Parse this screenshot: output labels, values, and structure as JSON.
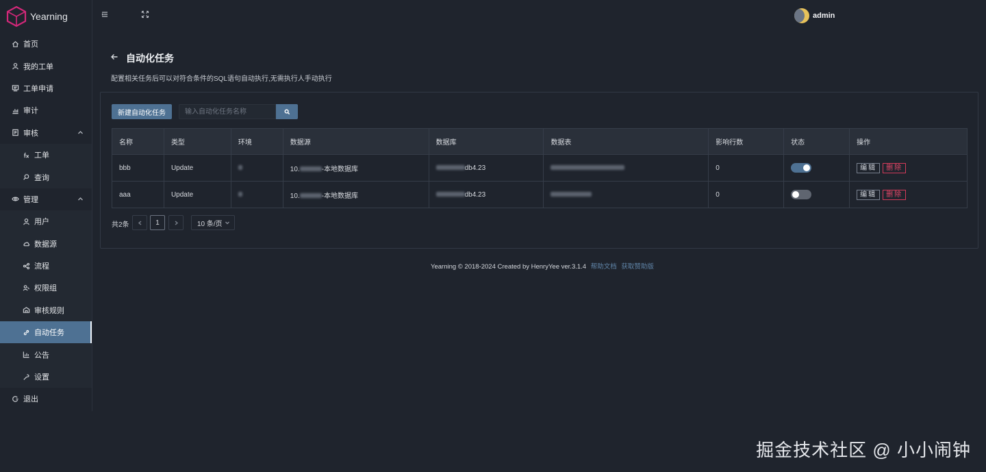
{
  "app": {
    "name": "Yearning"
  },
  "header": {
    "user_name": "admin"
  },
  "sidebar": {
    "items": [
      {
        "label": "首页",
        "icon": "home-icon"
      },
      {
        "label": "我的工单",
        "icon": "user-icon"
      },
      {
        "label": "工单申请",
        "icon": "form-icon"
      },
      {
        "label": "审计",
        "icon": "chart-icon"
      },
      {
        "label": "审核",
        "icon": "review-icon"
      },
      {
        "label": "工单",
        "icon": "fx-icon"
      },
      {
        "label": "查询",
        "icon": "search-icon"
      },
      {
        "label": "管理",
        "icon": "eye-icon"
      },
      {
        "label": "用户",
        "icon": "user-icon"
      },
      {
        "label": "数据源",
        "icon": "cloud-icon"
      },
      {
        "label": "流程",
        "icon": "share-icon"
      },
      {
        "label": "权限组",
        "icon": "permission-icon"
      },
      {
        "label": "审核规则",
        "icon": "rule-icon"
      },
      {
        "label": "自动任务",
        "icon": "link-icon"
      },
      {
        "label": "公告",
        "icon": "bar-chart-icon"
      },
      {
        "label": "设置",
        "icon": "wrench-icon"
      },
      {
        "label": "退出",
        "icon": "logout-icon"
      }
    ]
  },
  "page": {
    "title": "自动化任务",
    "description": "配置相关任务后可以对符合条件的SQL语句自动执行,无需执行人手动执行"
  },
  "toolbar": {
    "new_button": "新建自动化任务",
    "search_placeholder": "输入自动化任务名称"
  },
  "table": {
    "headers": [
      "名称",
      "类型",
      "环境",
      "数据源",
      "数据库",
      "数据表",
      "影响行数",
      "状态",
      "操作"
    ],
    "rows": [
      {
        "name": "bbb",
        "type": "Update",
        "source_suffix": "-本地数据库",
        "source_prefix": "10.",
        "db_suffix": "db4.23",
        "rows": "0",
        "enabled": true
      },
      {
        "name": "aaa",
        "type": "Update",
        "source_suffix": "-本地数据库",
        "source_prefix": "10.",
        "db_suffix": "db4.23",
        "rows": "0",
        "enabled": false
      }
    ],
    "edit_label": "编辑",
    "delete_label": "删除"
  },
  "pagination": {
    "total": "共2条",
    "current_page": "1",
    "page_size": "10 条/页"
  },
  "footer": {
    "text": "Yearning © 2018-2024 Created by HenryYee ver.3.1.4",
    "help_link": "帮助文档",
    "sponsor_link": "获取赞助版"
  },
  "watermark": "掘金技术社区 @ 小小闹钟"
}
